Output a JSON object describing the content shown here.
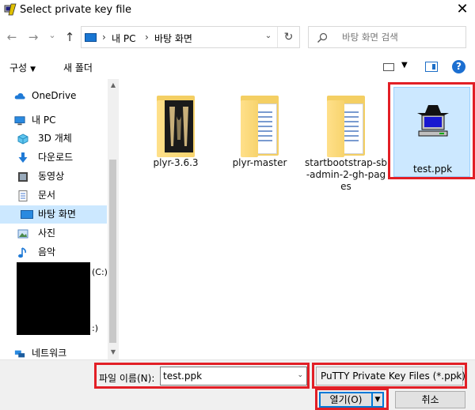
{
  "window": {
    "title": "Select private key file",
    "close_glyph": "✕"
  },
  "nav": {
    "back_glyph": "←",
    "forward_glyph": "→",
    "recent_glyph": "⌄",
    "up_glyph": "↑",
    "breadcrumbs": [
      "내 PC",
      "바탕 화면"
    ],
    "breadcrumb_sep": "›",
    "address_dropdown_glyph": "⌄",
    "refresh_glyph": "↻",
    "search_placeholder": "바탕 화면 검색",
    "search_icon": "search-icon"
  },
  "toolbar": {
    "organize": "구성",
    "new_folder": "새 폴더",
    "help": "?"
  },
  "sidebar": {
    "items": [
      {
        "label": "OneDrive",
        "icon": "cloud-icon"
      },
      {
        "label": "내 PC",
        "icon": "pc-icon"
      },
      {
        "label": "3D 개체",
        "icon": "cube-icon"
      },
      {
        "label": "다운로드",
        "icon": "download-icon"
      },
      {
        "label": "동영상",
        "icon": "video-icon"
      },
      {
        "label": "문서",
        "icon": "document-icon"
      },
      {
        "label": "바탕 화면",
        "icon": "desktop-icon",
        "selected": true
      },
      {
        "label": "사진",
        "icon": "picture-icon"
      },
      {
        "label": "음악",
        "icon": "music-icon"
      },
      {
        "label": "네트워크",
        "icon": "network-icon"
      }
    ],
    "drive_c_suffix": "(C:)",
    "drive_2_suffix": ":)"
  },
  "files": [
    {
      "name": "plyr-3.6.3",
      "type": "folder-app"
    },
    {
      "name": "plyr-master",
      "type": "folder"
    },
    {
      "name": "startbootstrap-sb-admin-2-gh-pages",
      "type": "folder"
    },
    {
      "name": "test.ppk",
      "type": "putty-key",
      "selected": true
    }
  ],
  "footer": {
    "filename_label": "파일 이름(N):",
    "filename_value": "test.ppk",
    "filter_value": "PuTTY Private Key Files (*.ppk)",
    "open_label": "열기(O)",
    "cancel_label": "취소",
    "dropdown_glyph": "⌄"
  },
  "colors": {
    "highlight": "#e21f26",
    "selection": "#cce8ff",
    "accent": "#0078d7"
  }
}
